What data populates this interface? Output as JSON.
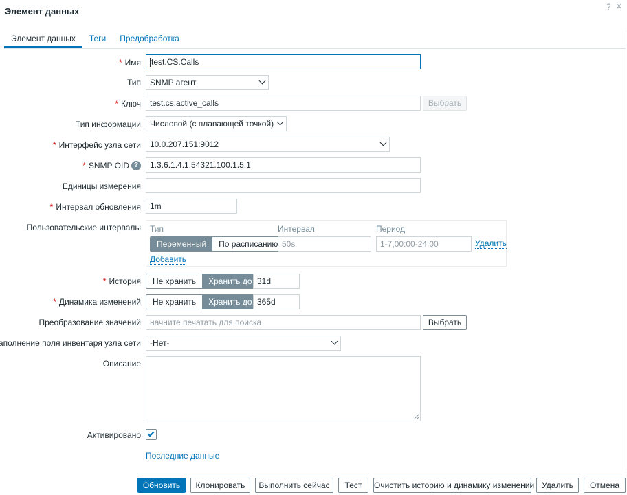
{
  "dialog": {
    "title": "Элемент данных",
    "help": "?",
    "close": "×"
  },
  "tabs": [
    {
      "label": "Элемент данных",
      "active": true
    },
    {
      "label": "Теги",
      "active": false
    },
    {
      "label": "Предобработка",
      "active": false
    }
  ],
  "form": {
    "name": {
      "label": "Имя",
      "value": "test.CS.Calls"
    },
    "type": {
      "label": "Тип",
      "value": "SNMP агент"
    },
    "key": {
      "label": "Ключ",
      "value": "test.cs.active_calls",
      "button": "Выбрать"
    },
    "info_type": {
      "label": "Тип информации",
      "value": "Числовой (с плавающей точкой)"
    },
    "interface": {
      "label": "Интерфейс узла сети",
      "value": "10.0.207.151:9012"
    },
    "snmp_oid": {
      "label": "SNMP OID",
      "value": "1.3.6.1.4.1.54321.100.1.5.1",
      "help": "?"
    },
    "units": {
      "label": "Единицы измерения",
      "value": ""
    },
    "update_interval": {
      "label": "Интервал обновления",
      "value": "1m"
    },
    "custom_intervals": {
      "label": "Пользовательские интервалы",
      "headers": {
        "type": "Тип",
        "interval": "Интервал",
        "period": "Период"
      },
      "type_options": [
        "Переменный",
        "По расписанию"
      ],
      "type_selected": "Переменный",
      "interval_placeholder": "50s",
      "period_placeholder": "1-7,00:00-24:00",
      "remove": "Удалить",
      "add": "Добавить"
    },
    "history": {
      "label": "История",
      "options": [
        "Не хранить",
        "Хранить до"
      ],
      "selected": "Хранить до",
      "value": "31d"
    },
    "trends": {
      "label": "Динамика изменений",
      "options": [
        "Не хранить",
        "Хранить до"
      ],
      "selected": "Хранить до",
      "value": "365d"
    },
    "valuemap": {
      "label": "Преобразование значений",
      "placeholder": "начните печатать для поиска",
      "button": "Выбрать"
    },
    "inventory": {
      "label": "Заполнение поля инвентаря узла сети",
      "value": "-Нет-"
    },
    "description": {
      "label": "Описание",
      "value": ""
    },
    "enabled": {
      "label": "Активировано",
      "checked": true
    },
    "latest_data": "Последние данные"
  },
  "footer": {
    "update": "Обновить",
    "clone": "Клонировать",
    "execute_now": "Выполнить сейчас",
    "test": "Тест",
    "clear": "Очистить историю и динамику изменений",
    "delete": "Удалить",
    "cancel": "Отмена"
  },
  "colors": {
    "accent": "#0275b8",
    "required": "#d40000",
    "segment_on": "#768d99"
  }
}
